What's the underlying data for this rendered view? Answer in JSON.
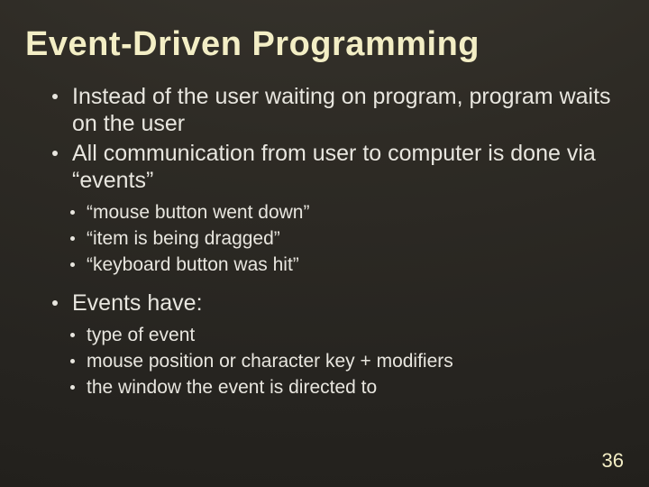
{
  "slide": {
    "title": "Event-Driven Programming",
    "bullets": {
      "b1": "Instead of the user waiting on program, program waits on the user",
      "b2": "All communication from user to computer is done via “events”",
      "b2_sub": {
        "s1": "“mouse button went down”",
        "s2": "“item is being dragged”",
        "s3": "“keyboard button was hit”"
      },
      "b3": "Events have:",
      "b3_sub": {
        "s1": "type of event",
        "s2": "mouse position or character key + modifiers",
        "s3": "the window the event is directed to"
      }
    },
    "page_number": "36"
  }
}
